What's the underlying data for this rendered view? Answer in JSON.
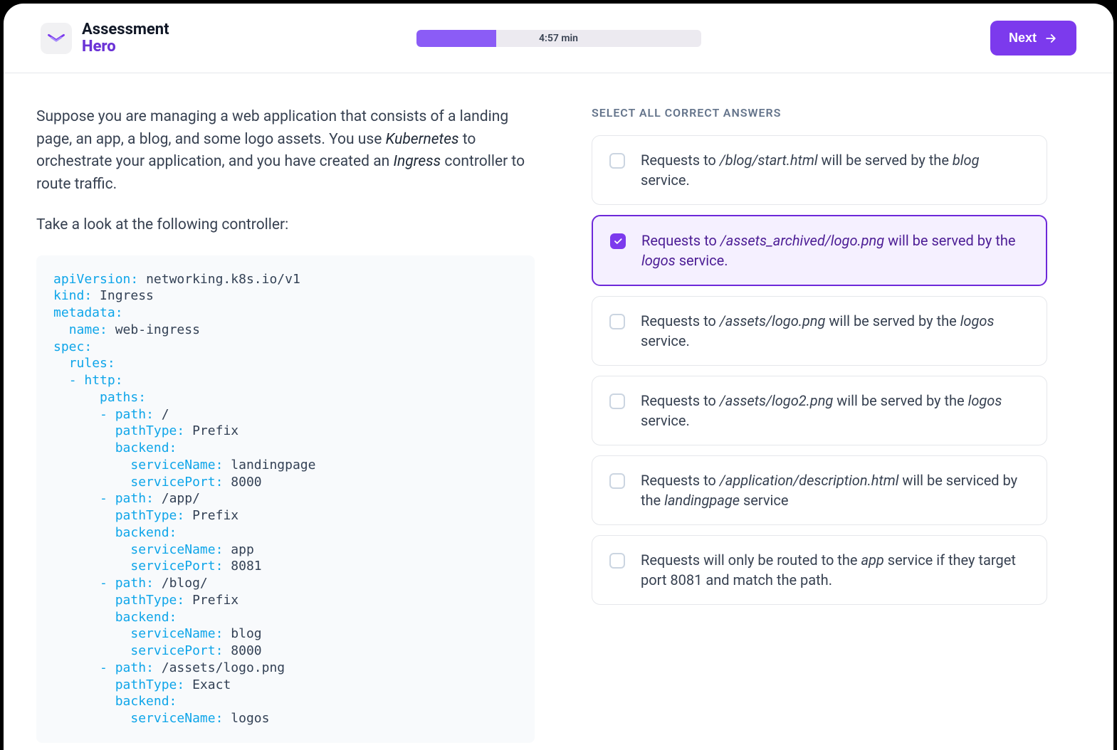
{
  "brand": {
    "line1": "Assessment",
    "line2": "Hero"
  },
  "timer": {
    "label": "4:57 min",
    "progress_pct": 28
  },
  "next_button": {
    "label": "Next"
  },
  "question": {
    "p1_pre": "Suppose you are managing a web application that consists of a landing page, an app, a blog, and some logo assets. You use ",
    "p1_em1": "Kubernetes",
    "p1_mid": " to orchestrate your application, and you have created an ",
    "p1_em2": "Ingress",
    "p1_post": " controller to route traffic.",
    "p2": "Take a look at the following controller:"
  },
  "code": {
    "k_apiVersion": "apiVersion:",
    "v_apiVersion": "networking.k8s.io/v1",
    "k_kind": "kind:",
    "v_kind": "Ingress",
    "k_metadata": "metadata:",
    "k_name": "name:",
    "v_name": "web-ingress",
    "k_spec": "spec:",
    "k_rules": "rules:",
    "k_http": "http:",
    "k_paths": "paths:",
    "dash": "-",
    "k_path": "path:",
    "k_pathType": "pathType:",
    "k_backend": "backend:",
    "k_serviceName": "serviceName:",
    "k_servicePort": "servicePort:",
    "v_path1": "/",
    "v_pt1": "Prefix",
    "v_sn1": "landingpage",
    "v_sp1": "8000",
    "v_path2": "/app/",
    "v_pt2": "Prefix",
    "v_sn2": "app",
    "v_sp2": "8081",
    "v_path3": "/blog/",
    "v_pt3": "Prefix",
    "v_sn3": "blog",
    "v_sp3": "8000",
    "v_path4": "/assets/logo.png",
    "v_pt4": "Exact",
    "v_sn4": "logos"
  },
  "answers_title": "SELECT ALL CORRECT ANSWERS",
  "answers": [
    {
      "selected": false,
      "pre": "Requests to ",
      "em": "/blog/start.html",
      "mid": " will be served by the ",
      "em2": "blog",
      "post": " service."
    },
    {
      "selected": true,
      "pre": "Requests to ",
      "em": "/assets_archived/logo.png",
      "mid": " will be served by the ",
      "em2": "logos",
      "post": " service."
    },
    {
      "selected": false,
      "pre": "Requests to ",
      "em": "/assets/logo.png",
      "mid": " will be served by the ",
      "em2": "logos",
      "post": " service."
    },
    {
      "selected": false,
      "pre": "Requests to ",
      "em": "/assets/logo2.png",
      "mid": " will be served by the ",
      "em2": "logos",
      "post": " service."
    },
    {
      "selected": false,
      "pre": "Requests to ",
      "em": "/application/description.html",
      "mid": " will be serviced by the ",
      "em2": "landingpage",
      "post": " service"
    },
    {
      "selected": false,
      "pre": "Requests will only be routed to the ",
      "em": "app",
      "mid": " service if they target port 8081 and match the path.",
      "em2": "",
      "post": ""
    }
  ]
}
